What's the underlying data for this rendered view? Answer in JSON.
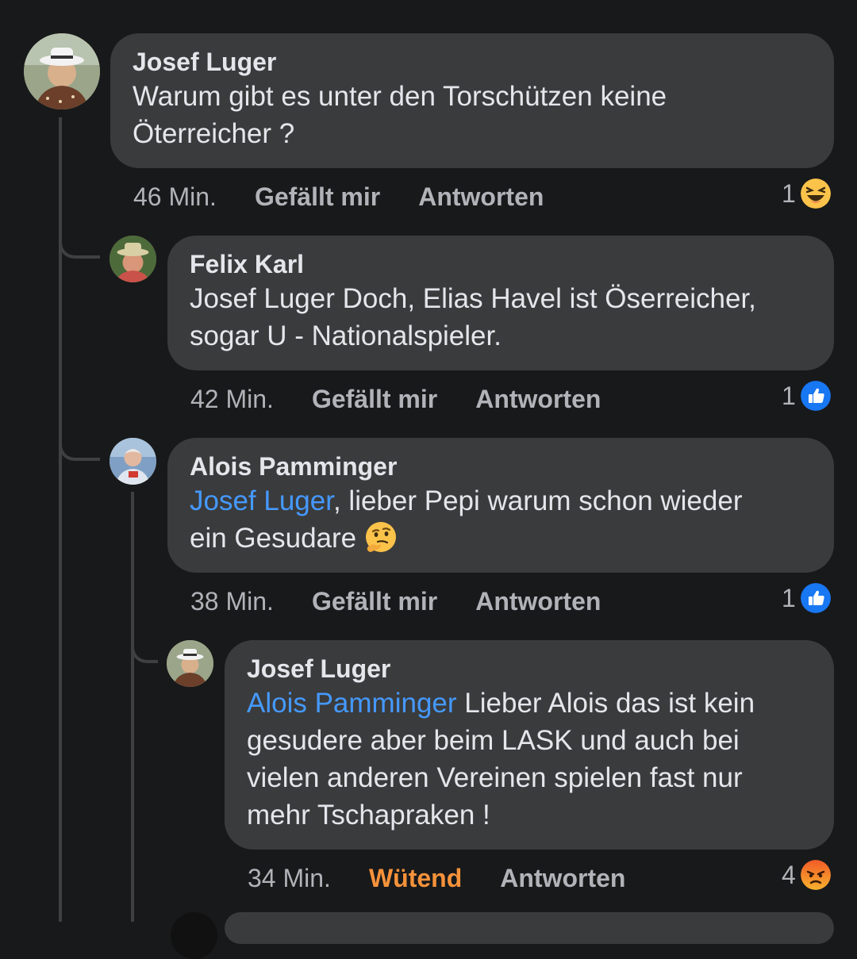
{
  "comments": [
    {
      "author": "Josef Luger",
      "text_line1": "Warum gibt es unter den Torschützen keine",
      "text_line2": "Öterreicher ?",
      "time": "46 Min.",
      "like_label": "Gefällt mir",
      "reply_label": "Antworten",
      "reaction_count": "1",
      "reaction_icon": "laughing-emoji-icon"
    },
    {
      "author": "Felix Karl",
      "text_line1": "Josef Luger Doch, Elias Havel ist Öserreicher,",
      "text_line2": "sogar U - Nationalspieler.",
      "time": "42 Min.",
      "like_label": "Gefällt mir",
      "reply_label": "Antworten",
      "reaction_count": "1",
      "reaction_icon": "like-thumb-icon"
    },
    {
      "author": "Alois Pamminger",
      "mention": "Josef Luger",
      "text_line1_rest": ", lieber Pepi warum schon wieder",
      "text_line2": "ein Gesudare",
      "text_emoji": "thinking-face-icon",
      "time": "38 Min.",
      "like_label": "Gefällt mir",
      "reply_label": "Antworten",
      "reaction_count": "1",
      "reaction_icon": "like-thumb-icon"
    },
    {
      "author": "Josef Luger",
      "mention": "Alois Pamminger",
      "text_line1_rest": " Lieber Alois das ist kein",
      "text_line2": "gesudere aber beim LASK und auch bei",
      "text_line3": "vielen anderen Vereinen spielen fast nur",
      "text_line4": "mehr Tschapraken !",
      "time": "34 Min.",
      "like_label": "Wütend",
      "reply_label": "Antworten",
      "reaction_count": "4",
      "reaction_icon": "angry-emoji-icon"
    }
  ],
  "colors": {
    "background": "#18191a",
    "bubble": "#3a3b3c",
    "mention": "#4599ff",
    "angry": "#f7923b",
    "like_blue": "#1877f2"
  }
}
